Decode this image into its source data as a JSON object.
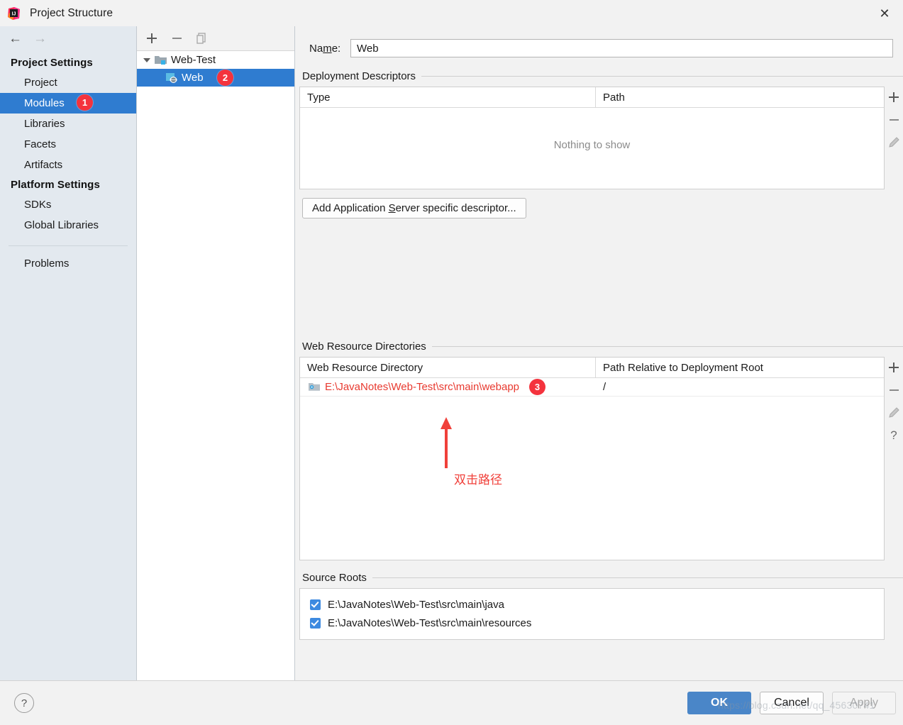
{
  "window": {
    "title": "Project Structure",
    "app_icon": "intellij-idea-icon",
    "close_icon": "✕"
  },
  "sidebar": {
    "nav": {
      "back_icon": "←",
      "forward_icon": "→"
    },
    "groups": [
      {
        "title": "Project Settings",
        "items": [
          {
            "label": "Project",
            "selected": false
          },
          {
            "label": "Modules",
            "selected": true,
            "badge": "1"
          },
          {
            "label": "Libraries",
            "selected": false
          },
          {
            "label": "Facets",
            "selected": false
          },
          {
            "label": "Artifacts",
            "selected": false
          }
        ]
      },
      {
        "title": "Platform Settings",
        "items": [
          {
            "label": "SDKs",
            "selected": false
          },
          {
            "label": "Global Libraries",
            "selected": false
          }
        ]
      }
    ],
    "problems_label": "Problems"
  },
  "tree_panel": {
    "toolbar": [
      {
        "name": "add-module-button",
        "glyph": "+"
      },
      {
        "name": "remove-module-button",
        "glyph": "−"
      },
      {
        "name": "copy-module-button",
        "glyph": "copy"
      }
    ],
    "nodes": [
      {
        "label": "Web-Test",
        "icon": "module-folder-icon",
        "selected": false,
        "depth": 0
      },
      {
        "label": "Web",
        "icon": "web-facet-icon",
        "selected": true,
        "depth": 1,
        "badge": "2"
      }
    ]
  },
  "main": {
    "name_field": {
      "label": "Name:",
      "label_mnemonic": "m",
      "value": "Web"
    },
    "deployment_descriptors": {
      "title": "Deployment Descriptors",
      "columns": [
        "Type",
        "Path"
      ],
      "rows": [],
      "empty_text": "Nothing to show",
      "toolbar": [
        {
          "name": "add-descriptor-button",
          "glyph": "+"
        },
        {
          "name": "remove-descriptor-button",
          "glyph": "−"
        },
        {
          "name": "edit-descriptor-button",
          "glyph": "pencil"
        }
      ],
      "add_button_label": "Add Application Server specific descriptor...",
      "add_button_mnemonic": "S"
    },
    "web_resource_directories": {
      "title": "Web Resource Directories",
      "columns": [
        "Web Resource Directory",
        "Path Relative to Deployment Root"
      ],
      "rows": [
        {
          "directory": "E:\\JavaNotes\\Web-Test\\src\\main\\webapp",
          "relative_path": "/",
          "icon": "web-resource-folder-icon",
          "badge": "3"
        }
      ],
      "toolbar": [
        {
          "name": "add-web-resource-button",
          "glyph": "+"
        },
        {
          "name": "remove-web-resource-button",
          "glyph": "−"
        },
        {
          "name": "edit-web-resource-button",
          "glyph": "pencil"
        },
        {
          "name": "help-web-resource-button",
          "glyph": "?"
        }
      ]
    },
    "source_roots": {
      "title": "Source Roots",
      "items": [
        {
          "label": "E:\\JavaNotes\\Web-Test\\src\\main\\java",
          "checked": true
        },
        {
          "label": "E:\\JavaNotes\\Web-Test\\src\\main\\resources",
          "checked": true
        }
      ]
    }
  },
  "footer": {
    "help_glyph": "?",
    "ok_label": "OK",
    "cancel_label": "Cancel",
    "apply_label": "Apply"
  },
  "annotations": {
    "arrow_color": "#f0403a",
    "note_text": "双击路径",
    "watermark": "https://blog.csdn.net/qq_45630741"
  },
  "colors": {
    "selection_blue": "#2f7cd0",
    "badge_red": "#f4333d",
    "primary_button": "#4a86c8",
    "path_red": "#e8392f"
  }
}
